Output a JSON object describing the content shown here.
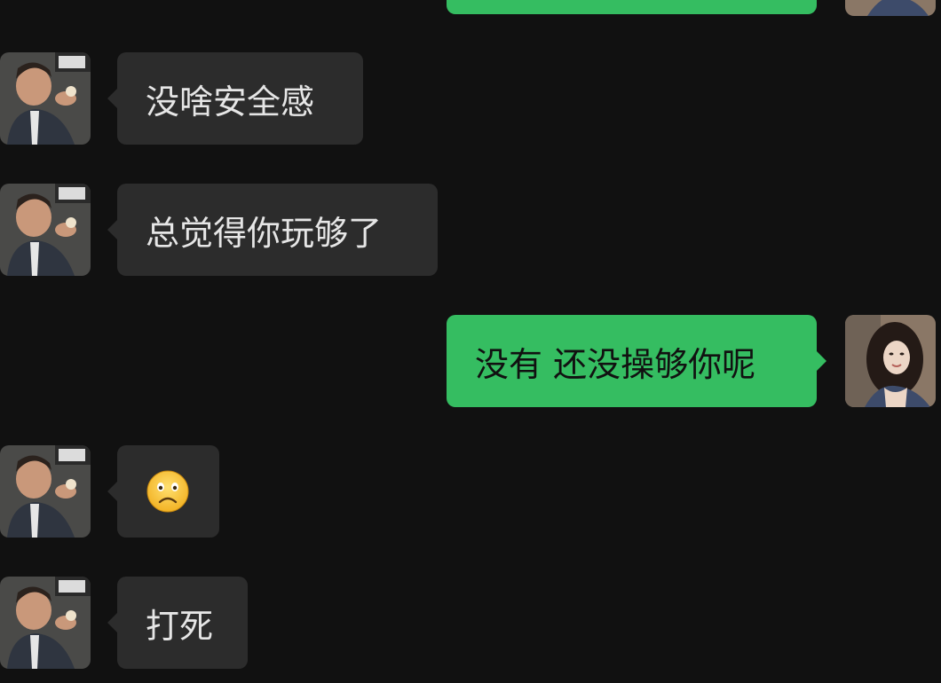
{
  "chat": {
    "messages": [
      {
        "side": "right",
        "text": ""
      },
      {
        "side": "left",
        "text": "没啥安全感"
      },
      {
        "side": "left",
        "text": "总觉得你玩够了"
      },
      {
        "side": "right",
        "text": "没有 还没操够你呢"
      },
      {
        "side": "left",
        "emoji": "frowning-face-emoji"
      },
      {
        "side": "left",
        "text": "打死"
      }
    ]
  },
  "colors": {
    "background": "#111111",
    "incoming_bubble": "#2c2c2c",
    "outgoing_bubble": "#35bd61"
  }
}
